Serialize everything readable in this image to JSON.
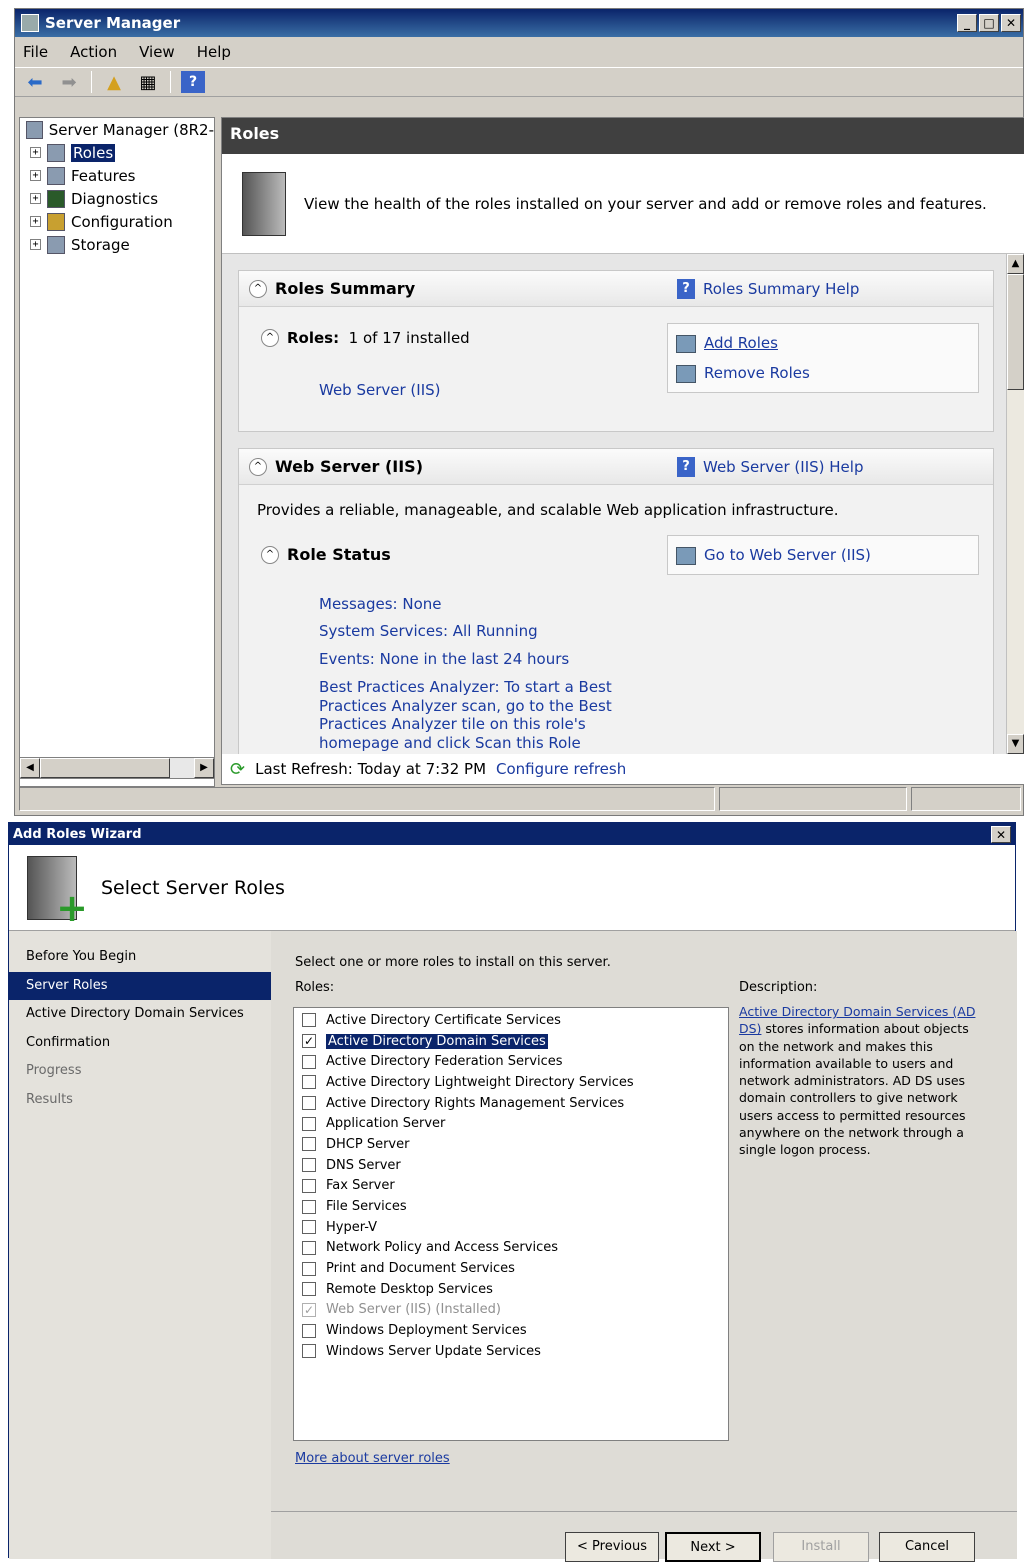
{
  "server_manager": {
    "title": "Server Manager",
    "menu": [
      "File",
      "Action",
      "View",
      "Help"
    ],
    "tree": {
      "root": "Server Manager (8R2-",
      "items": [
        "Roles",
        "Features",
        "Diagnostics",
        "Configuration",
        "Storage"
      ]
    },
    "header": "Roles",
    "intro_text": "View the health of the roles installed on your server and add or remove roles and features.",
    "roles_summary": {
      "title": "Roles Summary",
      "help": "Roles Summary Help",
      "roles_label": "Roles:",
      "roles_count": "1 of 17 installed",
      "installed_role": "Web Server (IIS)",
      "add_roles": "Add Roles",
      "remove_roles": "Remove Roles"
    },
    "web_server": {
      "title": "Web Server (IIS)",
      "help": "Web Server (IIS) Help",
      "description": "Provides a reliable, manageable, and scalable Web application infrastructure.",
      "role_status_title": "Role Status",
      "goto": "Go to Web Server (IIS)",
      "messages": "Messages: None",
      "services": "System Services: All Running",
      "events": "Events: None in the last 24 hours",
      "bpa": "Best Practices Analyzer: To start a Best Practices Analyzer scan, go to the Best Practices Analyzer tile on this role's homepage and click Scan this Role"
    },
    "last_refresh": "Last Refresh: Today at 7:32 PM",
    "configure_refresh": "Configure refresh"
  },
  "wizard": {
    "title": "Add Roles Wizard",
    "heading": "Select Server Roles",
    "nav": [
      "Before You Begin",
      "Server Roles",
      "Active Directory Domain Services",
      "Confirmation",
      "Progress",
      "Results"
    ],
    "instruction": "Select one or more roles to install on this server.",
    "roles_label": "Roles:",
    "description_label": "Description:",
    "description_link": "Active Directory Domain Services (AD DS)",
    "description_text": " stores information about objects on the network and makes this information available to users and network administrators. AD DS uses domain controllers to give network users access to permitted resources anywhere on the network through a single logon process.",
    "roles": [
      {
        "name": "Active Directory Certificate Services",
        "checked": false
      },
      {
        "name": "Active Directory Domain Services",
        "checked": true
      },
      {
        "name": "Active Directory Federation Services",
        "checked": false
      },
      {
        "name": "Active Directory Lightweight Directory Services",
        "checked": false
      },
      {
        "name": "Active Directory Rights Management Services",
        "checked": false
      },
      {
        "name": "Application Server",
        "checked": false
      },
      {
        "name": "DHCP Server",
        "checked": false
      },
      {
        "name": "DNS Server",
        "checked": false
      },
      {
        "name": "Fax Server",
        "checked": false
      },
      {
        "name": "File Services",
        "checked": false
      },
      {
        "name": "Hyper-V",
        "checked": false
      },
      {
        "name": "Network Policy and Access Services",
        "checked": false
      },
      {
        "name": "Print and Document Services",
        "checked": false
      },
      {
        "name": "Remote Desktop Services",
        "checked": false
      },
      {
        "name": "Web Server (IIS)  (Installed)",
        "checked": true
      },
      {
        "name": "Windows Deployment Services",
        "checked": false
      },
      {
        "name": "Windows Server Update Services",
        "checked": false
      }
    ],
    "more_link": "More about server roles",
    "buttons": {
      "previous": "< Previous",
      "next": "Next >",
      "install": "Install",
      "cancel": "Cancel"
    }
  }
}
